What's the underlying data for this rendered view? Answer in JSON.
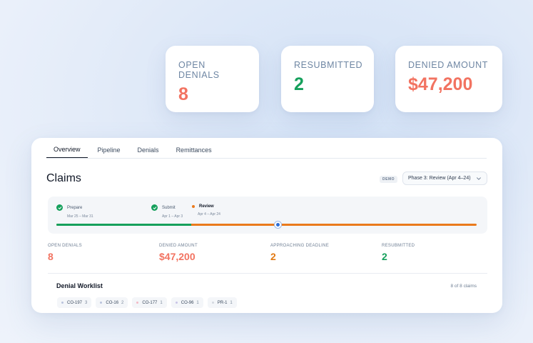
{
  "colors": {
    "coral": "#f27361",
    "green": "#16a05c",
    "orange": "#e27a13",
    "blue": "#2f6fd6"
  },
  "stat_cards": {
    "open_denials": {
      "label": "OPEN DENIALS",
      "value": "8"
    },
    "resubmitted": {
      "label": "RESUBMITTED",
      "value": "2"
    },
    "denied_amount": {
      "label": "DENIED AMOUNT",
      "value": "$47,200"
    }
  },
  "tabs": [
    {
      "label": "Overview",
      "active": true
    },
    {
      "label": "Pipeline",
      "active": false
    },
    {
      "label": "Denials",
      "active": false
    },
    {
      "label": "Remittances",
      "active": false
    }
  ],
  "page_title": "Claims",
  "demo_badge": "DEMO",
  "phase_select": {
    "selected": "Phase 3: Review (Apr 4–24)"
  },
  "timeline": {
    "steps": [
      {
        "name": "Prepare",
        "dates": "Mar 25 – Mar 31",
        "status": "done"
      },
      {
        "name": "Submit",
        "dates": "Apr 1 – Apr 3",
        "status": "done"
      },
      {
        "name": "Review",
        "dates": "Apr 4 – Apr 24",
        "status": "current"
      }
    ]
  },
  "stats": [
    {
      "label": "OPEN DENIALS",
      "value": "8",
      "color": "#f27361"
    },
    {
      "label": "DENIED AMOUNT",
      "value": "$47,200",
      "color": "#f27361"
    },
    {
      "label": "APPROACHING DEADLINE",
      "value": "2",
      "color": "#e27a13"
    },
    {
      "label": "RESUBMITTED",
      "value": "2",
      "color": "#16a05c"
    }
  ],
  "worklist": {
    "title": "Denial Worklist",
    "count": "8 of 8 claims",
    "chips": [
      {
        "code": "CO-197",
        "count": "3",
        "dot": "#b9c3dc"
      },
      {
        "code": "CO-16",
        "count": "2",
        "dot": "#b9c3dc"
      },
      {
        "code": "CO-177",
        "count": "1",
        "dot": "#f3b8c4"
      },
      {
        "code": "CO-96",
        "count": "1",
        "dot": "#c9c3e6"
      },
      {
        "code": "PR-1",
        "count": "1",
        "dot": "#d4d8e0"
      }
    ]
  }
}
